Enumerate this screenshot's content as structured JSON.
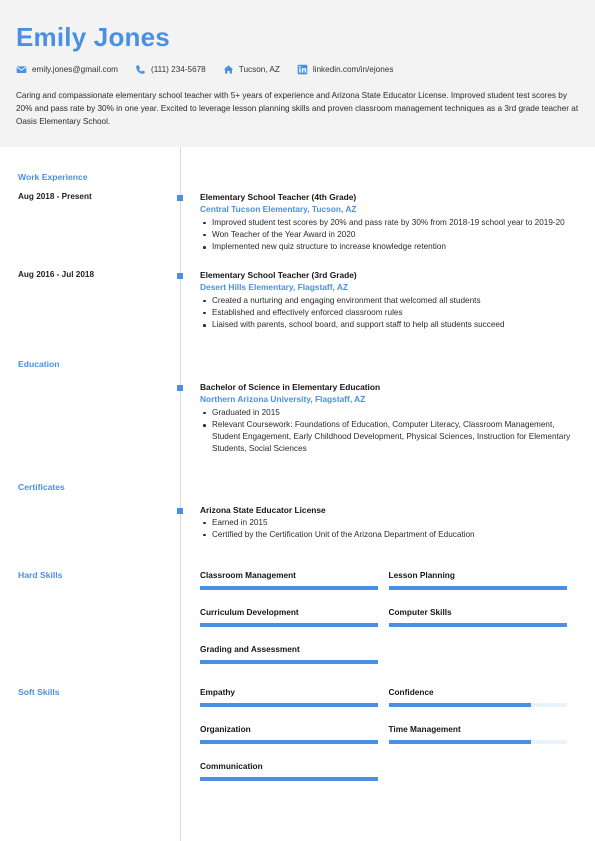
{
  "header": {
    "name": "Emily Jones",
    "contacts": [
      {
        "icon": "email-icon",
        "text": "emily.jones@gmail.com"
      },
      {
        "icon": "phone-icon",
        "text": "(111) 234-5678"
      },
      {
        "icon": "home-icon",
        "text": "Tucson, AZ"
      },
      {
        "icon": "linkedin-icon",
        "text": "linkedin.com/in/ejones"
      }
    ],
    "summary": "Caring and compassionate elementary school teacher with 5+ years of experience and Arizona State Educator License. Improved student test scores by 20% and pass rate by 30% in one year. Excited to leverage lesson planning skills and proven classroom management techniques as a 3rd grade teacher at Oasis Elementary School."
  },
  "colors": {
    "accent": "#4a90e2",
    "header_background": "#f3f3f4",
    "text": "#2b2b2b",
    "divider": "#d8d8d8",
    "bar_track": "#eaf2fb"
  },
  "sections": {
    "work_experience": {
      "title": "Work Experience",
      "entries": [
        {
          "dates": "Aug 2018 - Present",
          "title": "Elementary School Teacher (4th Grade)",
          "subtitle": "Central Tucson Elementary, Tucson, AZ",
          "bullets": [
            "Improved student test scores by 20% and pass rate by 30% from 2018-19 school year to 2019-20",
            "Won Teacher of the Year Award in 2020",
            "Implemented new quiz structure to increase knowledge retention"
          ]
        },
        {
          "dates": "Aug 2016 - Jul 2018",
          "title": "Elementary School Teacher (3rd Grade)",
          "subtitle": "Desert Hills Elementary, Flagstaff, AZ",
          "bullets": [
            "Created a nurturing and engaging environment that welcomed all students",
            "Established and effectively enforced classroom rules",
            "Liaised with parents, school board, and support staff to help all students succeed"
          ]
        }
      ]
    },
    "education": {
      "title": "Education",
      "entries": [
        {
          "dates": "",
          "title": "Bachelor of Science in Elementary Education",
          "subtitle": "Northern Arizona University, Flagstaff, AZ",
          "bullets": [
            "Graduated in 2015",
            "Relevant Coursework: Foundations of Education, Computer Literacy, Classroom Management, Student Engagement, Early Childhood Development, Physical Sciences, Instruction for Elementary Students, Social Sciences"
          ]
        }
      ]
    },
    "certificates": {
      "title": "Certificates",
      "entries": [
        {
          "dates": "",
          "title": "Arizona State Educator License",
          "subtitle": "",
          "bullets": [
            "Earned in 2015",
            "Certified by the Certification Unit of the Arizona Department of Education"
          ]
        }
      ]
    },
    "hard_skills": {
      "title": "Hard Skills",
      "skills": [
        {
          "name": "Classroom Management",
          "level": 100
        },
        {
          "name": "Lesson Planning",
          "level": 100
        },
        {
          "name": "Curriculum Development",
          "level": 100
        },
        {
          "name": "Computer Skills",
          "level": 100
        },
        {
          "name": "Grading and Assessment",
          "level": 100
        }
      ]
    },
    "soft_skills": {
      "title": "Soft Skills",
      "skills": [
        {
          "name": "Empathy",
          "level": 100
        },
        {
          "name": "Confidence",
          "level": 80
        },
        {
          "name": "Organization",
          "level": 100
        },
        {
          "name": "Time Management",
          "level": 80
        },
        {
          "name": "Communication",
          "level": 100
        }
      ]
    }
  }
}
